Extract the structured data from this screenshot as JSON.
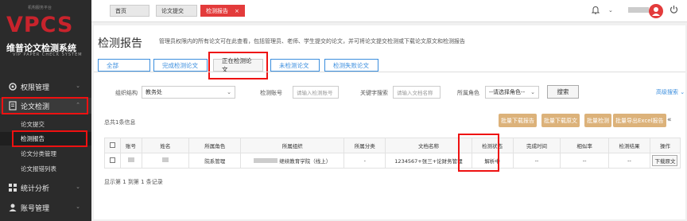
{
  "brand": {
    "small": "机构服务平台",
    "logo": "VPCS",
    "name_cn": "维普论文检测系统",
    "name_en": "VIP PAPER CHECK SYSTEM",
    "accent": "#c8232c"
  },
  "sidebar": {
    "groups": [
      {
        "label": "权限管理",
        "icon": "gear-icon"
      },
      {
        "label": "论文检测",
        "icon": "document-icon"
      },
      {
        "label": "统计分析",
        "icon": "grid-icon"
      },
      {
        "label": "账号管理",
        "icon": "user-icon"
      }
    ],
    "sub_items": [
      {
        "label": "论文提交"
      },
      {
        "label": "检测报告"
      },
      {
        "label": "论文分类管理"
      },
      {
        "label": "论文报错列表"
      }
    ]
  },
  "topbar": {
    "tabs": [
      {
        "label": "首页"
      },
      {
        "label": "论文提交"
      },
      {
        "label": "检测报告",
        "close": "×"
      }
    ],
    "bell_icon": "bell-icon",
    "power_icon": "power-icon"
  },
  "page": {
    "title": "检测报告",
    "description": "管理员权限内的所有论文可在此查看，包括管理员、老师、学生提交的论文，并可将论文提交检测或下载论文原文和检测报告"
  },
  "filter_tabs": [
    {
      "label": "全部"
    },
    {
      "label": "完成检测论文"
    },
    {
      "label": "正在检测论文"
    },
    {
      "label": "未检测论文"
    },
    {
      "label": "检测失败论文"
    }
  ],
  "search": {
    "org_label": "组织结构",
    "org_value": "教务处",
    "account_label": "检测账号",
    "account_placeholder": "请输入检测账号",
    "keyword_label": "关键字搜索",
    "keyword_placeholder": "请输入文档名称",
    "role_label": "所属角色",
    "role_value": "--请选择角色--",
    "search_button": "搜索",
    "advanced": "高级搜索"
  },
  "total_text": "总共1条信息",
  "actions": {
    "batch_download_report": "批量下载报告",
    "batch_download_original": "批量下载原文",
    "batch_check": "批量检测",
    "batch_export_excel": "批量导出Excel报告"
  },
  "table": {
    "headers": [
      "",
      "账号",
      "姓名",
      "所属角色",
      "所属组织",
      "所属分类",
      "文档名称",
      "检测状态",
      "完成时间",
      "相似率",
      "检测结果",
      "操作"
    ],
    "rows": [
      {
        "account": "",
        "name": "",
        "role": "院系管理",
        "org": "继续教育学院（线上）",
        "category": "-",
        "doc": "1234567+张三+论财务管理",
        "status": "解析中",
        "finish_time": "--",
        "similarity": "--",
        "result": "--",
        "action": "下载原文"
      }
    ]
  },
  "pager": "显示第 1 到第 1 条记录"
}
